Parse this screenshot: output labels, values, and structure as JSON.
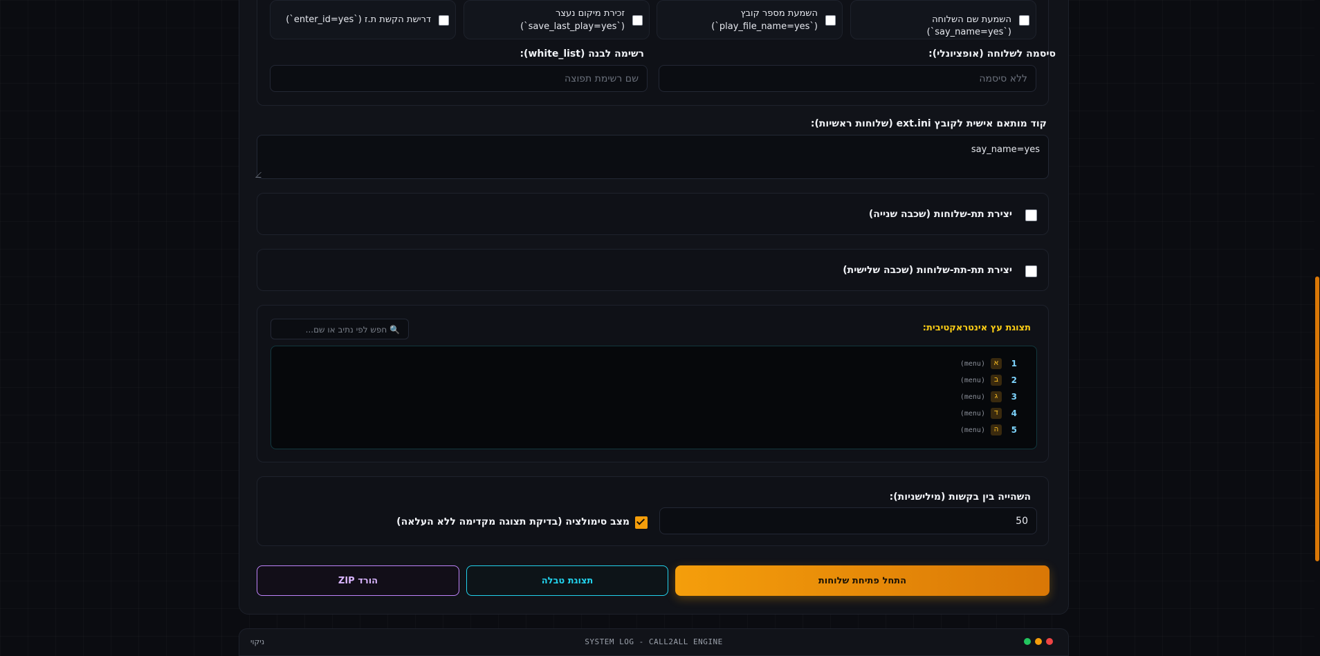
{
  "options": {
    "say_name": {
      "label": "השמעת שם השלוחה (`say_name=yes`)"
    },
    "play_file_name": {
      "line1": "השמעת מספר קובץ",
      "line2": "(`play_file_name=yes`)"
    },
    "save_last_play": {
      "line1": "זכירת מיקום נעצר",
      "line2": "(`save_last_play=yes`)"
    },
    "enter_id": {
      "label": "דרישת הקשת ת.ז (`enter_id=yes`)"
    }
  },
  "password": {
    "label": "סיסמה לשלוחה (אופציונלי):",
    "placeholder": "ללא סיסמה"
  },
  "white_list": {
    "label": "רשימה לבנה (white_list):",
    "placeholder": "שם רשימת תפוצה"
  },
  "custom_code": {
    "label": "קוד מותאם אישית לקובץ ext.ini (שלוחות ראשיות):",
    "value": "say_name=yes"
  },
  "sub_level2": {
    "label": "יצירת תת-שלוחות (שכבה שנייה)"
  },
  "sub_level3": {
    "label": "יצירת תת-תת-שלוחות (שכבה שלישית)"
  },
  "tree": {
    "title": "תצוגת עץ אינטראקטיבית:",
    "search_placeholder": "🔍 חפש לפי נתיב או שם...",
    "rows": [
      {
        "num": "1",
        "badge": "א",
        "type": "(menu)"
      },
      {
        "num": "2",
        "badge": "ב",
        "type": "(menu)"
      },
      {
        "num": "3",
        "badge": "ג",
        "type": "(menu)"
      },
      {
        "num": "4",
        "badge": "ד",
        "type": "(menu)"
      },
      {
        "num": "5",
        "badge": "ה",
        "type": "(menu)"
      }
    ]
  },
  "delay": {
    "label": "השהייה בין בקשות (מילישניות):",
    "value": "50"
  },
  "simulation": {
    "label": "מצב סימולציה (בדיקת תצוגה מקדימה ללא העלאה)",
    "checked": true
  },
  "buttons": {
    "start": "התחל פתיחת שלוחות",
    "table": "תצוגת טבלה",
    "zip": "הורד ZIP"
  },
  "log": {
    "title": "SYSTEM LOG - CALL2ALL ENGINE",
    "clear": "ניקוי"
  },
  "colors": {
    "accent": "#f59e0b",
    "cyan": "#22d3ee",
    "purple": "#c084fc",
    "title_yellow": "#facc15"
  }
}
